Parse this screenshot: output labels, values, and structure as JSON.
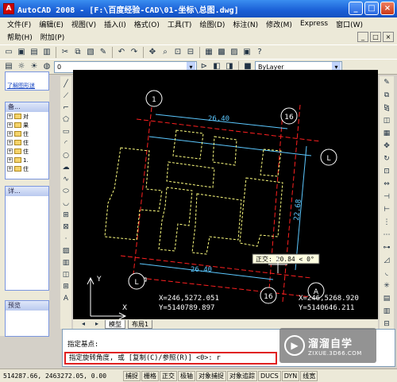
{
  "window": {
    "title": "AutoCAD 2008 - [F:\\百度经验-CAD\\01-坐标\\总图.dwg]",
    "app_icon": "autocad-logo-icon",
    "min_label": "_",
    "max_label": "□",
    "close_label": "×"
  },
  "menu": {
    "items": [
      "文件(F)",
      "编辑(E)",
      "视图(V)",
      "插入(I)",
      "格式(O)",
      "工具(T)",
      "绘图(D)",
      "标注(N)",
      "修改(M)",
      "Express",
      "窗口(W)"
    ],
    "items_row2": [
      "帮助(H)",
      "附加(P)"
    ],
    "mdi_min": "_",
    "mdi_max": "□",
    "mdi_close": "×"
  },
  "toolbar": {
    "layer_value": "0",
    "linetype_value": "ByLayer"
  },
  "left_panel": {
    "link_text": "了解图形迷",
    "section1_title": "备...",
    "tree_items": [
      "对",
      "果",
      "住",
      "住",
      "住",
      "1.",
      "住"
    ],
    "section2_title": "详...",
    "section3_title": "预览"
  },
  "drawing": {
    "grid_labels": [
      "1",
      "16",
      "L",
      "L",
      "A",
      "16"
    ],
    "dim_top": "26.40",
    "dim_bottom": "26.40",
    "dim_right": "22.68",
    "ortho_tooltip": "正交: 20.84 < 0°",
    "coord_left": [
      "X=246,5272.051",
      "Y=5140789.897"
    ],
    "coord_right": [
      "X=246,5268.920",
      "Y=5140646.211"
    ],
    "ucs_x": "X",
    "ucs_y": "Y",
    "colors": {
      "background": "#000000",
      "axis_red": "#ff2020",
      "building_yellow": "#ffff80",
      "dim_cyan": "#5cc8ff",
      "text_white": "#ffffff"
    }
  },
  "tabs": {
    "model": "模型",
    "layout1": "布局1"
  },
  "command": {
    "line1": "指定基点:",
    "line2": "指定旋转角度, 或 [复制(C)/参照(R)] <0>: r"
  },
  "status": {
    "coords": "514287.66, 2463272.05, 0.00",
    "buttons": [
      "捕捉",
      "栅格",
      "正交",
      "极轴",
      "对象捕捉",
      "对象追踪",
      "DUCS",
      "DYN",
      "线宽"
    ]
  },
  "watermark": {
    "main": "溜溜自学",
    "sub": "ZIXUE.3D66.COM",
    "logo": "play-logo-icon"
  }
}
